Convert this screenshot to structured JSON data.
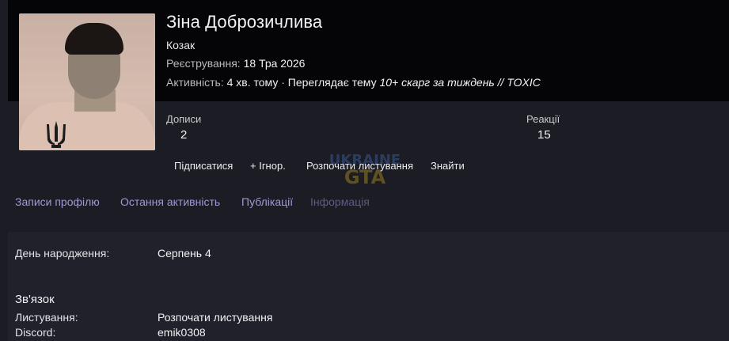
{
  "profile": {
    "username": "Зіна Доброзичлива",
    "title": "Козак",
    "registered_label": "Реєстрування:",
    "registered_value": "18 Тра 2026",
    "activity_label": "Активність:",
    "activity_value": "4 хв. тому",
    "activity_separator": "·",
    "activity_action": "Переглядає тему",
    "activity_thread": "10+ скарг за тиждень // TOXIC"
  },
  "stats": {
    "posts_label": "Дописи",
    "posts_value": "2",
    "reactions_label": "Реакції",
    "reactions_value": "15"
  },
  "actions": {
    "follow": "Підписатися",
    "ignore": "+ Ігнор.",
    "start_conversation": "Розпочати листування",
    "find": "Знайти"
  },
  "tabs": [
    {
      "label": "Записи профілю",
      "active": false
    },
    {
      "label": "Остання активність",
      "active": false
    },
    {
      "label": "Публікації",
      "active": false
    },
    {
      "label": "Інформація",
      "active": true
    }
  ],
  "info": {
    "birthday_label": "День народження:",
    "birthday_value": "Серпень 4",
    "contact_heading": "Зв'язок",
    "conversation_label": "Листування:",
    "conversation_value": "Розпочати листування",
    "discord_label": "Discord:",
    "discord_value": "emik0308"
  },
  "watermark": {
    "line1": "UKRAINE",
    "line2": "GTA"
  },
  "avatar": {
    "tattoo_icon": "trident-icon"
  },
  "colors": {
    "page_bg": "#1b1c24",
    "header_bg": "#050507",
    "panel_bg": "#20212b",
    "tab_link": "#9d99d9",
    "tab_active": "#5d5a83"
  }
}
